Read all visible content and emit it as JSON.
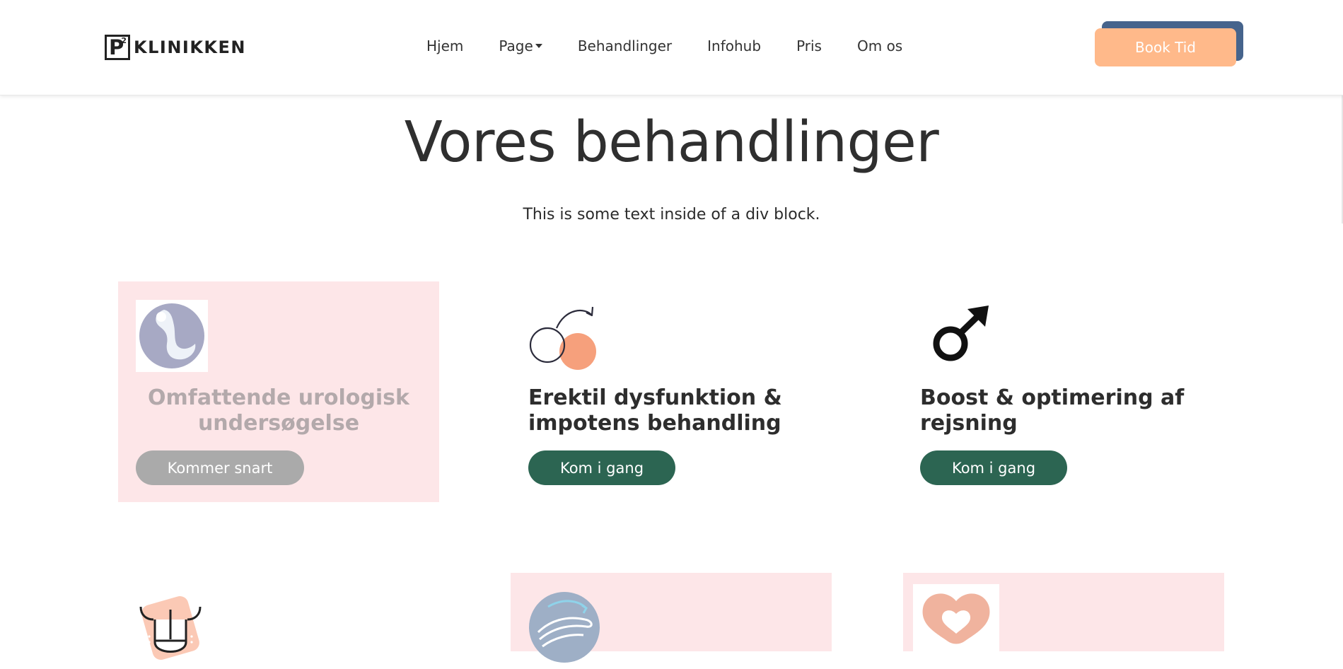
{
  "header": {
    "logo": {
      "mark_letter": "P",
      "mark_superscript": "2",
      "text": "KLINIKKEN"
    },
    "nav": [
      {
        "label": "Hjem"
      },
      {
        "label": "Page"
      },
      {
        "label": "Behandlinger"
      },
      {
        "label": "Infohub"
      },
      {
        "label": "Pris"
      },
      {
        "label": "Om os"
      }
    ],
    "cta_label": "Book Tid"
  },
  "hero": {
    "title": "Vores behandlinger",
    "subtitle": "This is some text inside of a div block."
  },
  "cards": [
    {
      "icon": "urology-organ-icon",
      "title": "Omfattende urologisk undersøgelse",
      "button": "Kommer snart",
      "state": "disabled"
    },
    {
      "icon": "erectile-dysfunction-icon",
      "title": "Erektil dysfunktion & impotens behandling",
      "button": "Kom i gang",
      "state": "active"
    },
    {
      "icon": "male-symbol-icon",
      "title": "Boost & optimering af rejsning",
      "button": "Kom i gang",
      "state": "active"
    },
    {
      "icon": "penis-anatomy-icon"
    },
    {
      "icon": "curvature-arrow-icon"
    },
    {
      "icon": "heart-ring-icon"
    }
  ],
  "colors": {
    "accent_orange": "#ffb98a",
    "accent_blue": "#46648c",
    "button_green": "#2c6552",
    "button_grey": "#aaaaaa",
    "card_pink": "#fde6e8",
    "icon_orange": "#f6a07c"
  }
}
